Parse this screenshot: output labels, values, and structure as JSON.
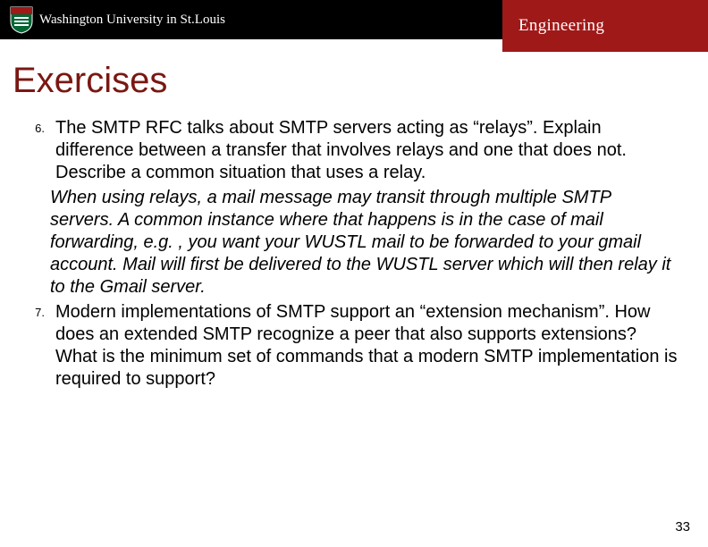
{
  "header": {
    "university": "Washington University in St.Louis",
    "school": "Engineering"
  },
  "title": "Exercises",
  "items": [
    {
      "num": "6.",
      "question": "The SMTP RFC talks about SMTP servers acting as “relays”. Explain difference between a transfer that involves relays and one that does not. Describe a common situation that uses a relay.",
      "answer": "When using relays, a mail message may transit through multiple SMTP servers.  A common instance where that happens is in the case of mail forwarding, e.g. , you want your WUSTL mail to be forwarded to your gmail account.  Mail will first be delivered to the WUSTL server which will then relay it to the Gmail server."
    },
    {
      "num": "7.",
      "question": "Modern implementations of SMTP support an “extension mechanism”. How does an extended SMTP recognize a peer that also supports extensions? What is the minimum set of commands that a modern SMTP implementation is required to support?",
      "answer": ""
    }
  ],
  "page_number": "33"
}
